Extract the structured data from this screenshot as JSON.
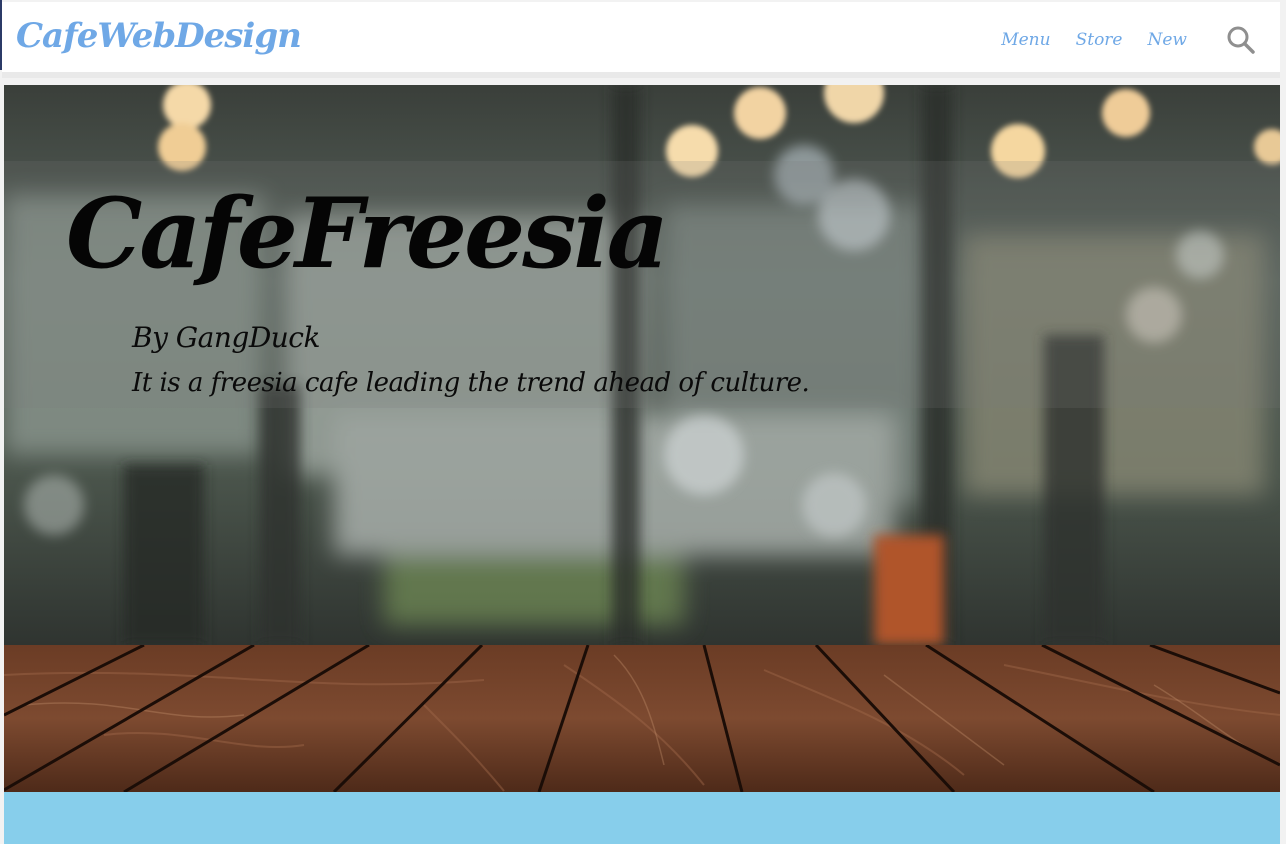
{
  "header": {
    "brand": "CafeWebDesign",
    "nav": [
      {
        "label": "Menu"
      },
      {
        "label": "Store"
      },
      {
        "label": "New"
      }
    ],
    "search_icon": "search-icon"
  },
  "hero": {
    "title": "CafeFreesia",
    "byline": "By GangDuck",
    "tagline": "It is a freesia cafe leading the trend ahead of culture."
  },
  "colors": {
    "brand": "#6fa8e6",
    "footer_band": "#87ceeb"
  }
}
